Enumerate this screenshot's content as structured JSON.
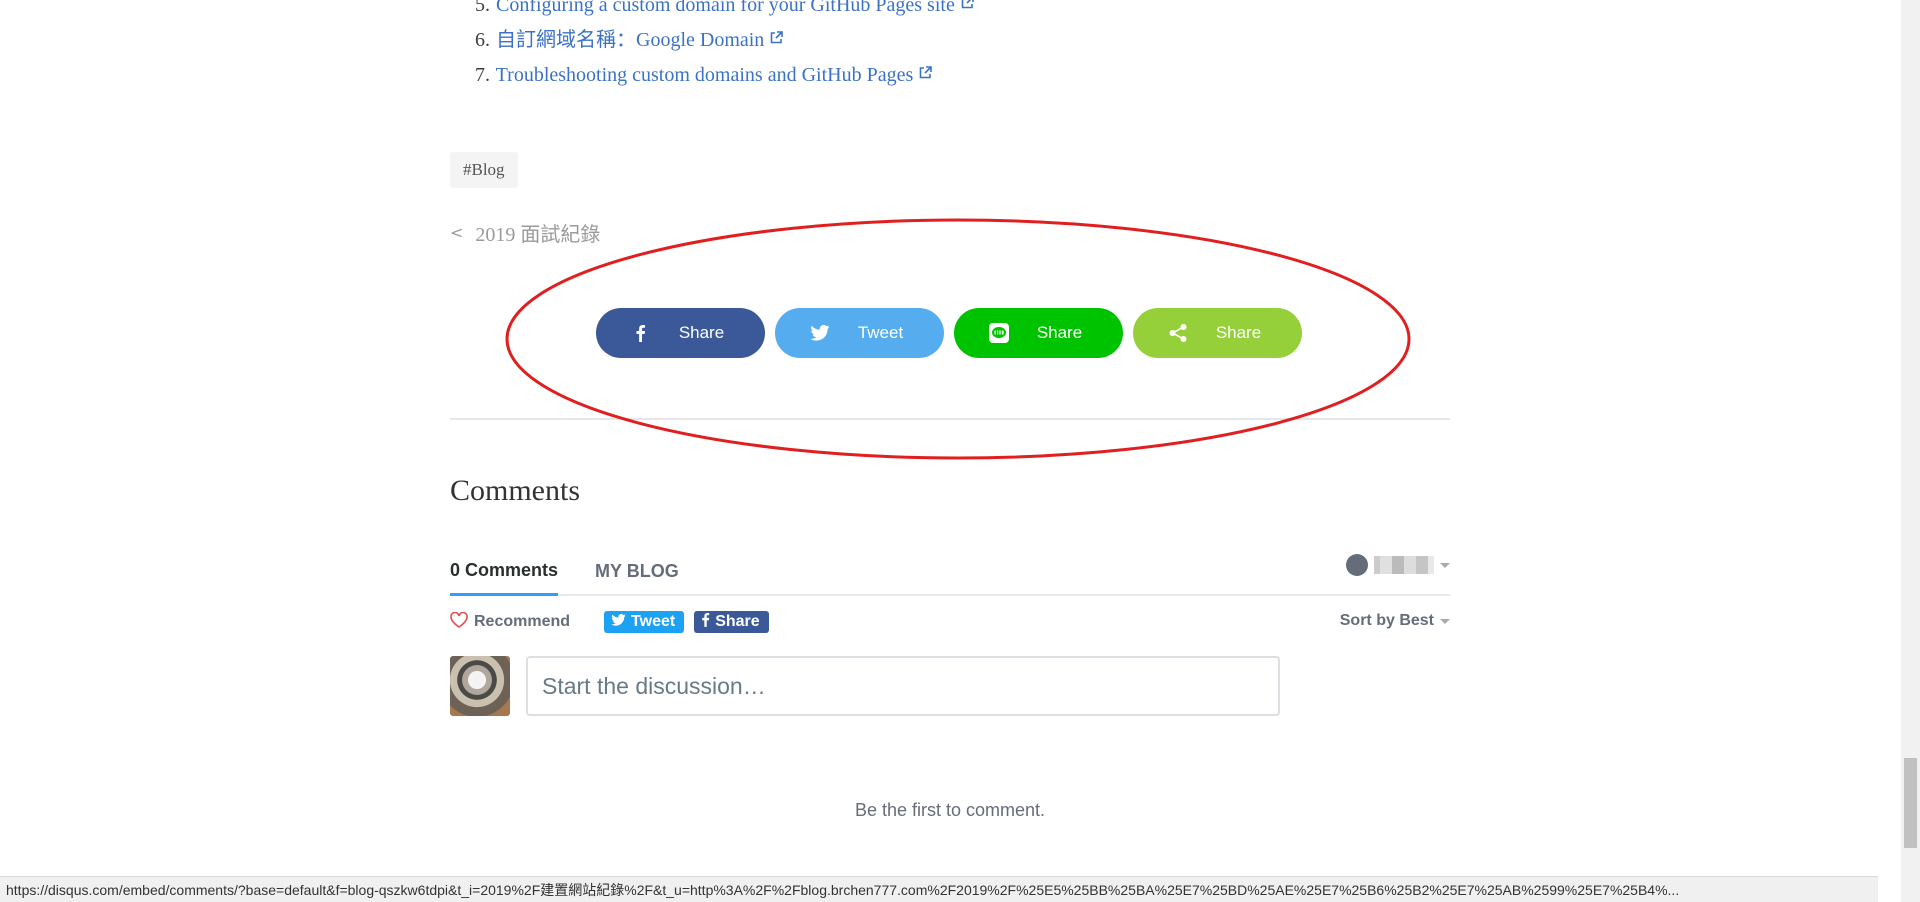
{
  "references": [
    {
      "num": "5.",
      "text": "Configuring a custom domain for your GitHub Pages site"
    },
    {
      "num": "6.",
      "text": "自訂網域名稱：Google Domain"
    },
    {
      "num": "7.",
      "text": "Troubleshooting custom domains and GitHub Pages"
    }
  ],
  "tag": "#Blog",
  "prev_post": {
    "label": "2019 面試紀錄"
  },
  "share_buttons": [
    {
      "label": "Share",
      "icon": "facebook-icon",
      "color": "#3b5998"
    },
    {
      "label": "Tweet",
      "icon": "twitter-icon",
      "color": "#55acee"
    },
    {
      "label": "Share",
      "icon": "line-icon",
      "color": "#00c300"
    },
    {
      "label": "Share",
      "icon": "share-icon",
      "color": "#95d03a"
    }
  ],
  "annotation_color": "#e02020",
  "comments_heading": "Comments",
  "disqus": {
    "tabs": [
      {
        "label": "0 Comments",
        "active": true
      },
      {
        "label": "MY BLOG",
        "active": false
      }
    ],
    "recommend_label": "Recommend",
    "tweet_label": "Tweet",
    "share_label": "Share",
    "sort_label": "Sort by Best",
    "input_placeholder": "Start the discussion…",
    "empty_message": "Be the first to comment.",
    "accent_color": "#2e9fff"
  },
  "status_url": "https://disqus.com/embed/comments/?base=default&f=blog-qszkw6tdpi&t_i=2019%2F建置網站紀錄%2F&t_u=http%3A%2F%2Fblog.brchen777.com%2F2019%2F%25E5%25BB%25BA%25E7%25BD%25AE%25E7%25B6%25B2%25E7%25AB%2599%25E7%25B4%..."
}
